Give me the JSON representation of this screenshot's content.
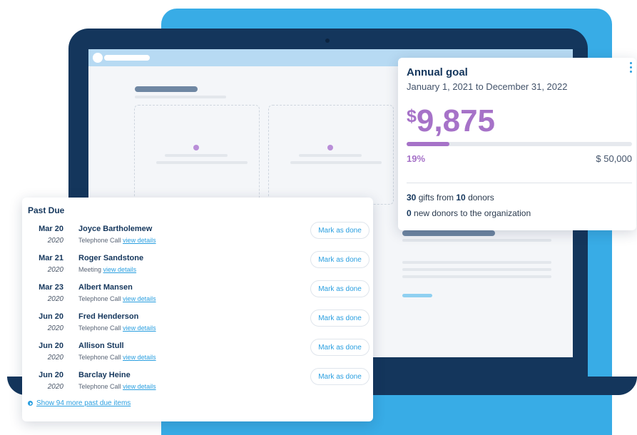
{
  "colors": {
    "accent": "#2a9fe0",
    "navy": "#14365c",
    "purple": "#a672c8",
    "backdrop": "#38ace6"
  },
  "goal": {
    "title": "Annual goal",
    "dates": "January 1, 2021 to December 31, 2022",
    "currency": "$",
    "amount": "9,875",
    "progress_fraction": 0.19,
    "percent_label": "19%",
    "target": "$ 50,000",
    "gifts_count": "30",
    "gifts_text": " gifts from ",
    "donors_count": "10",
    "donors_text": " donors",
    "new_donors_count": "0",
    "new_donors_text": " new donors to the organization",
    "menu_icon": "more-vertical-icon"
  },
  "past_due": {
    "title": "Past Due",
    "button_label": "Mark as done",
    "link_label": "view details",
    "items": [
      {
        "date": "Mar 20",
        "year": "2020",
        "name": "Joyce Bartholemew",
        "type": "Telephone Call"
      },
      {
        "date": "Mar 21",
        "year": "2020",
        "name": "Roger Sandstone",
        "type": "Meeting"
      },
      {
        "date": "Mar 23",
        "year": "2020",
        "name": "Albert Mansen",
        "type": "Telephone Call"
      },
      {
        "date": "Jun 20",
        "year": "2020",
        "name": "Fred Henderson",
        "type": "Telephone Call"
      },
      {
        "date": "Jun 20",
        "year": "2020",
        "name": "Allison Stull",
        "type": "Telephone Call"
      },
      {
        "date": "Jun 20",
        "year": "2020",
        "name": "Barclay Heine",
        "type": "Telephone Call"
      }
    ],
    "more_label": "Show 94 more past due items",
    "more_icon": "chevron-right-circle-icon"
  }
}
